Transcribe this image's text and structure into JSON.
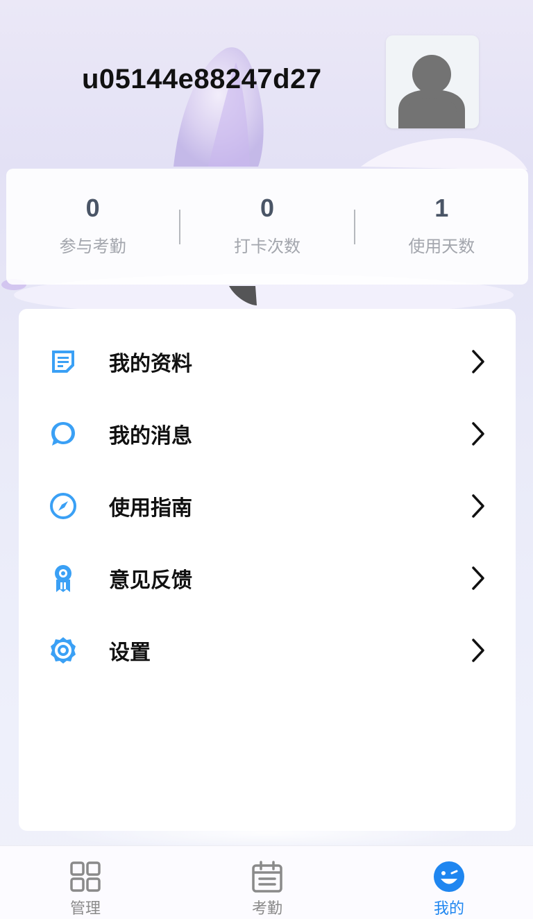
{
  "profile": {
    "username": "u05144e88247d27"
  },
  "stats": [
    {
      "value": "0",
      "label": "参与考勤"
    },
    {
      "value": "0",
      "label": "打卡次数"
    },
    {
      "value": "1",
      "label": "使用天数"
    }
  ],
  "menu": [
    {
      "label": "我的资料",
      "icon": "document-icon"
    },
    {
      "label": "我的消息",
      "icon": "message-bubble-icon"
    },
    {
      "label": "使用指南",
      "icon": "compass-icon"
    },
    {
      "label": "意见反馈",
      "icon": "medal-icon"
    },
    {
      "label": "设置",
      "icon": "gear-icon"
    }
  ],
  "tabbar": [
    {
      "label": "管理",
      "icon": "grid-icon",
      "active": false
    },
    {
      "label": "考勤",
      "icon": "calendar-icon",
      "active": false
    },
    {
      "label": "我的",
      "icon": "smiley-icon",
      "active": true
    }
  ],
  "colors": {
    "accent": "#1f86f0",
    "icon_blue": "#3aa0f5",
    "text_primary": "#111111",
    "stat_value": "#4a5566",
    "stat_label": "#a3a6ad",
    "tab_inactive": "#8a8a8a"
  }
}
